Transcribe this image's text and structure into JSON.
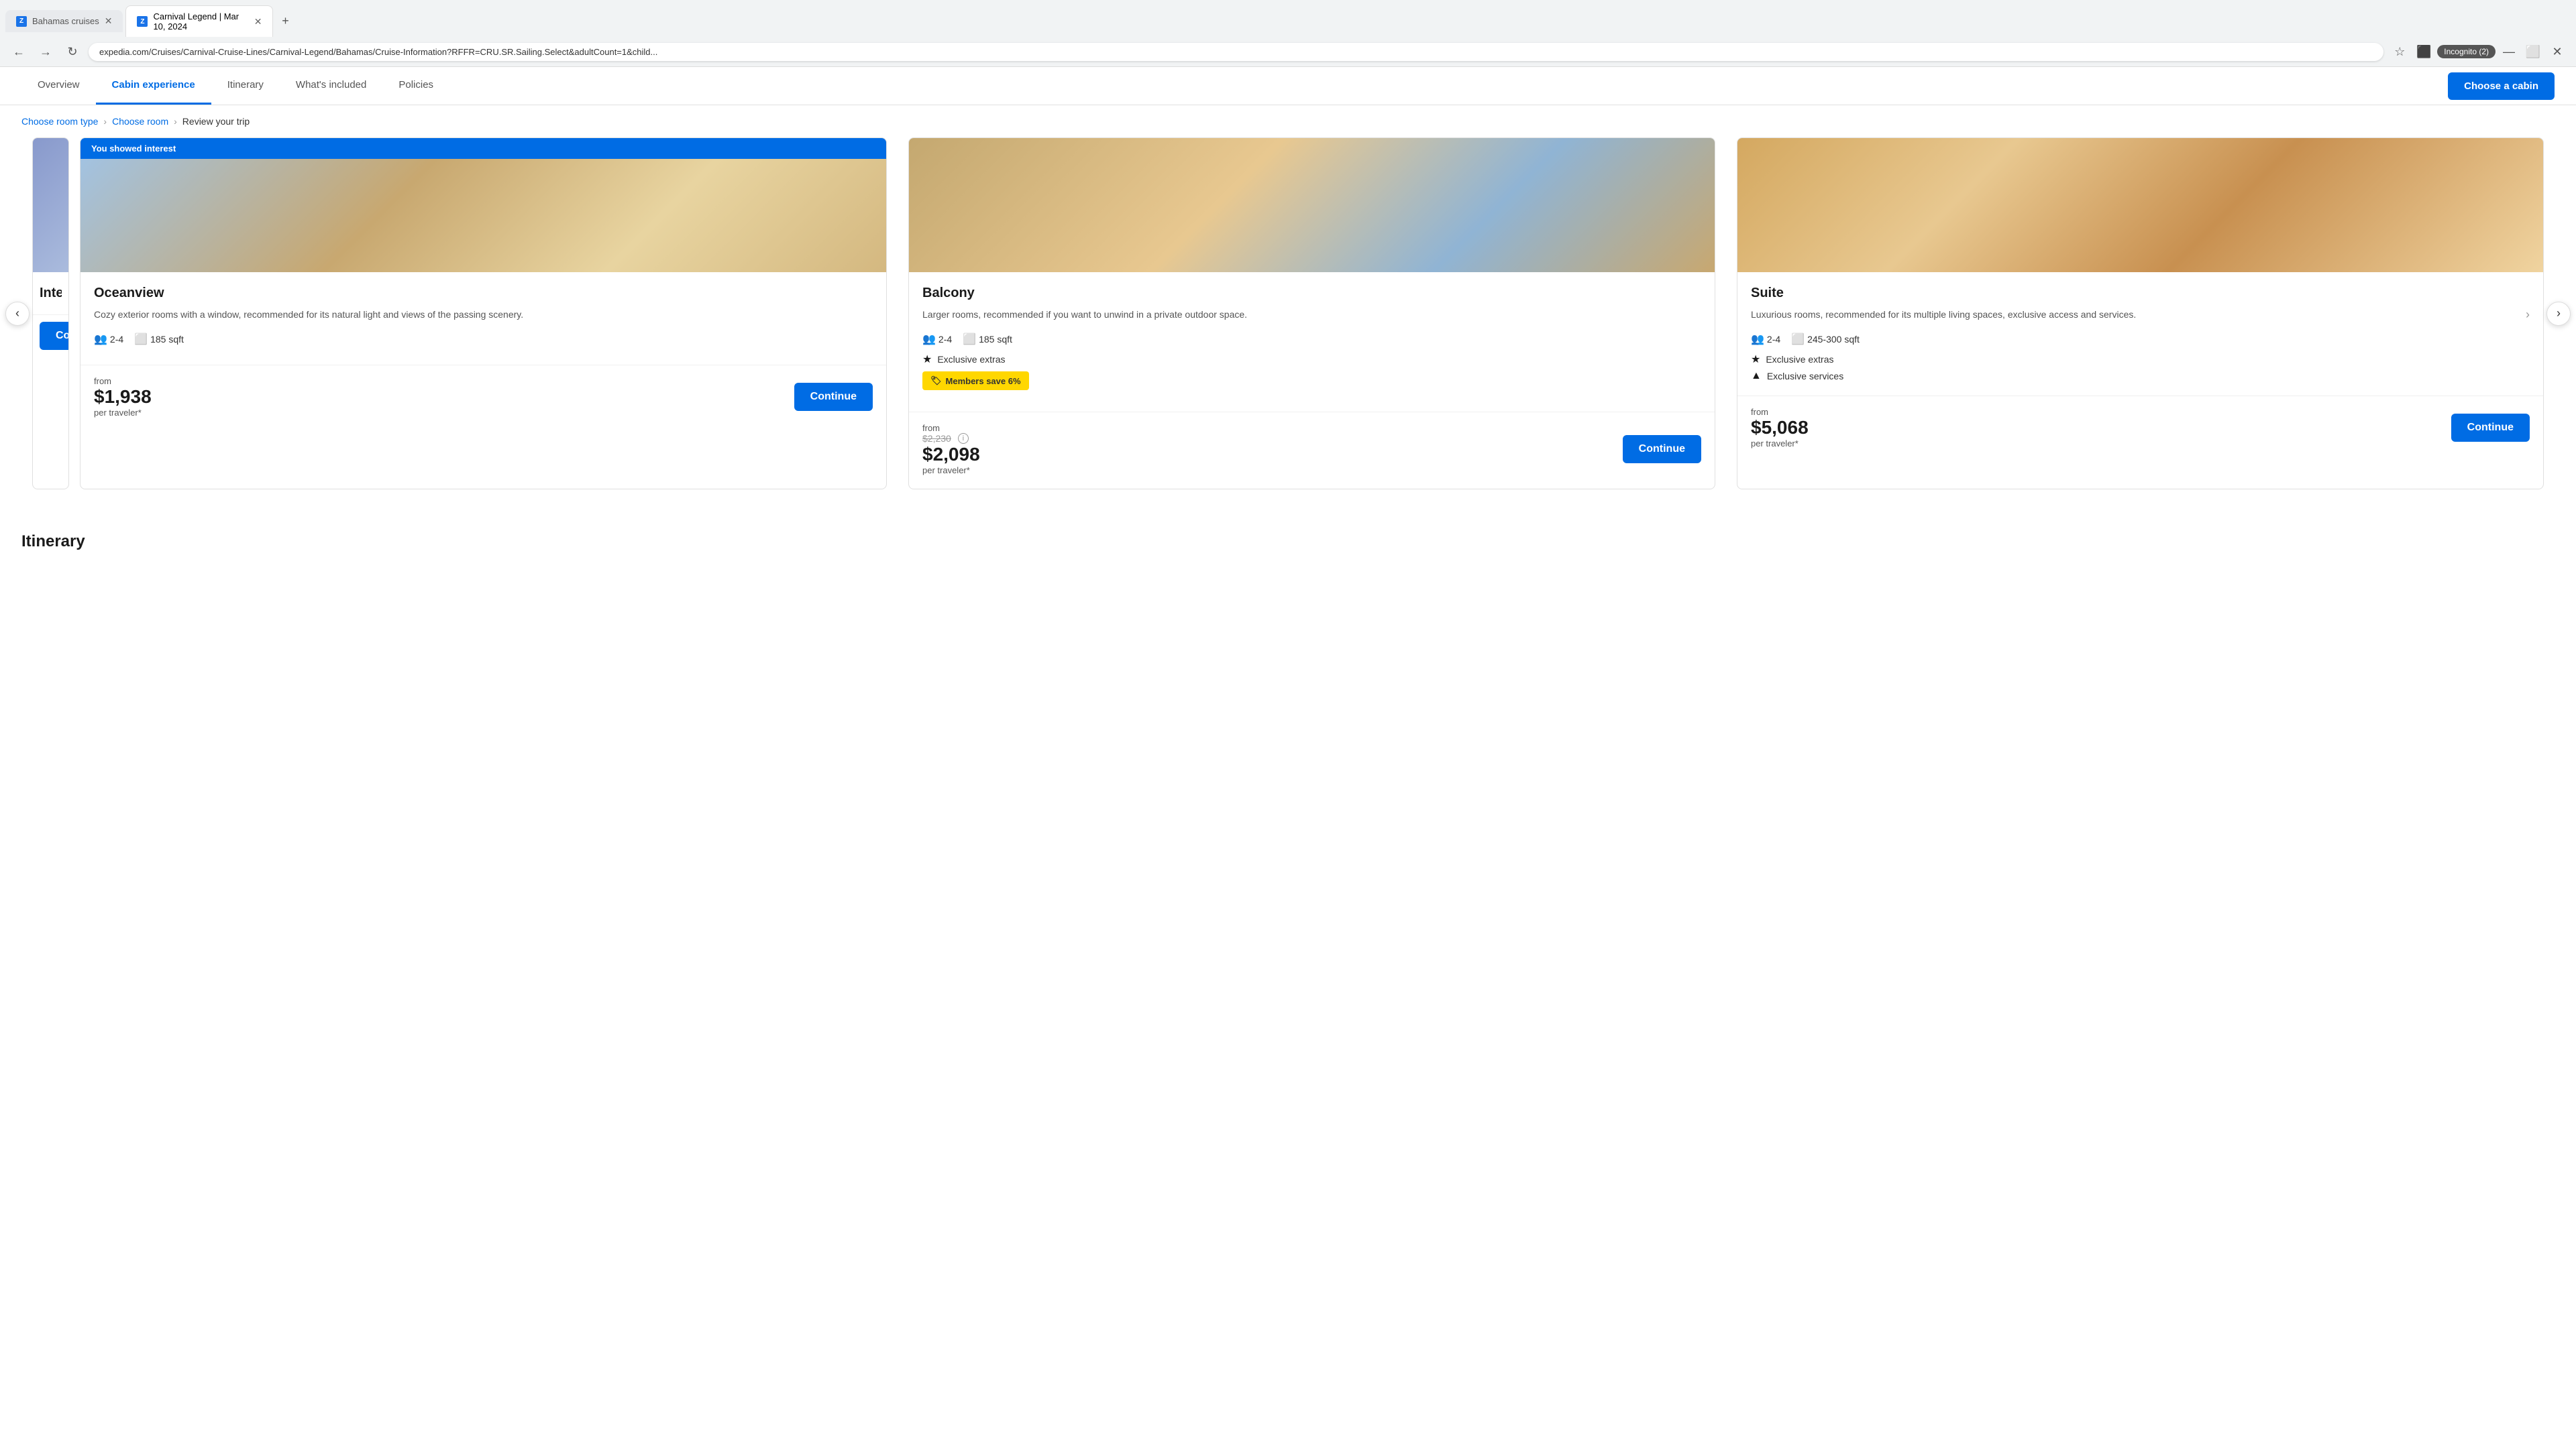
{
  "browser": {
    "tabs": [
      {
        "id": "tab1",
        "favicon": "Z",
        "label": "Bahamas cruises",
        "active": false
      },
      {
        "id": "tab2",
        "favicon": "Z",
        "label": "Carnival Legend | Mar 10, 2024",
        "active": true
      }
    ],
    "address": "expedia.com/Cruises/Carnival-Cruise-Lines/Carnival-Legend/Bahamas/Cruise-Information?RFFR=CRU.SR.Sailing.Select&adultCount=1&child...",
    "incognito_label": "Incognito (2)"
  },
  "nav": {
    "tabs": [
      {
        "id": "overview",
        "label": "Overview",
        "active": false
      },
      {
        "id": "cabin-experience",
        "label": "Cabin experience",
        "active": true
      },
      {
        "id": "itinerary",
        "label": "Itinerary",
        "active": false
      },
      {
        "id": "whats-included",
        "label": "What's included",
        "active": false
      },
      {
        "id": "policies",
        "label": "Policies",
        "active": false
      }
    ],
    "cta_button": "Choose a cabin"
  },
  "breadcrumb": {
    "items": [
      {
        "id": "choose-room-type",
        "label": "Choose room type",
        "link": true
      },
      {
        "id": "choose-room",
        "label": "Choose room",
        "link": true
      },
      {
        "id": "review-trip",
        "label": "Review your trip",
        "link": false
      }
    ]
  },
  "cards": {
    "prev_arrow": "‹",
    "next_arrow": "›",
    "items": [
      {
        "id": "oceanview",
        "interest_badge": "You showed interest",
        "has_badge": true,
        "name": "Oceanview",
        "description": "Cozy exterior rooms with a window, recommended for its natural light and views of the passing scenery.",
        "capacity": "2-4",
        "sqft": "185 sqft",
        "features": [],
        "members_badge": null,
        "from_label": "from",
        "price_main": "$1,938",
        "price_per": "per traveler*",
        "continue_label": "Continue"
      },
      {
        "id": "balcony",
        "interest_badge": null,
        "has_badge": false,
        "name": "Balcony",
        "description": "Larger rooms, recommended if you want to unwind in a private outdoor space.",
        "capacity": "2-4",
        "sqft": "185 sqft",
        "features": [
          {
            "icon": "★",
            "label": "Exclusive extras"
          }
        ],
        "members_badge": "Members save 6%",
        "from_label": "from",
        "price_original": "$2,230",
        "price_main": "$2,098",
        "price_per": "per traveler*",
        "continue_label": "Continue"
      },
      {
        "id": "suite",
        "interest_badge": null,
        "has_badge": false,
        "name": "Suite",
        "description": "Luxurious rooms, recommended for its multiple living spaces, exclusive access and services.",
        "capacity": "2-4",
        "sqft": "245-300 sqft",
        "features": [
          {
            "icon": "★",
            "label": "Exclusive extras"
          },
          {
            "icon": "▲",
            "label": "Exclusive services"
          }
        ],
        "members_badge": null,
        "from_label": "from",
        "price_main": "$5,068",
        "price_per": "per traveler*",
        "continue_label": "Continue"
      }
    ]
  },
  "itinerary": {
    "title": "Itinerary"
  }
}
